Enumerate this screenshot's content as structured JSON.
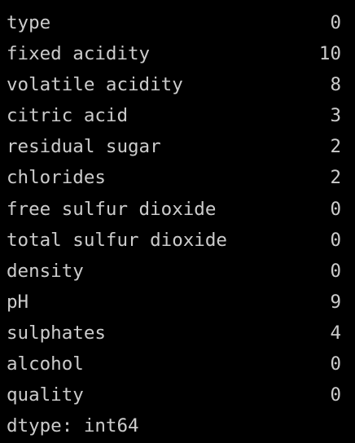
{
  "output": {
    "rows": [
      {
        "name": "type",
        "value": "0"
      },
      {
        "name": "fixed acidity",
        "value": "10"
      },
      {
        "name": "volatile acidity",
        "value": "8"
      },
      {
        "name": "citric acid",
        "value": "3"
      },
      {
        "name": "residual sugar",
        "value": "2"
      },
      {
        "name": "chlorides",
        "value": "2"
      },
      {
        "name": "free sulfur dioxide",
        "value": "0"
      },
      {
        "name": "total sulfur dioxide",
        "value": "0"
      },
      {
        "name": "density",
        "value": "0"
      },
      {
        "name": "pH",
        "value": "9"
      },
      {
        "name": "sulphates",
        "value": "4"
      },
      {
        "name": "alcohol",
        "value": "0"
      },
      {
        "name": "quality",
        "value": "0"
      }
    ],
    "dtype": "dtype: int64"
  },
  "colors": {
    "background": "#000000",
    "text": "#cccccc"
  }
}
